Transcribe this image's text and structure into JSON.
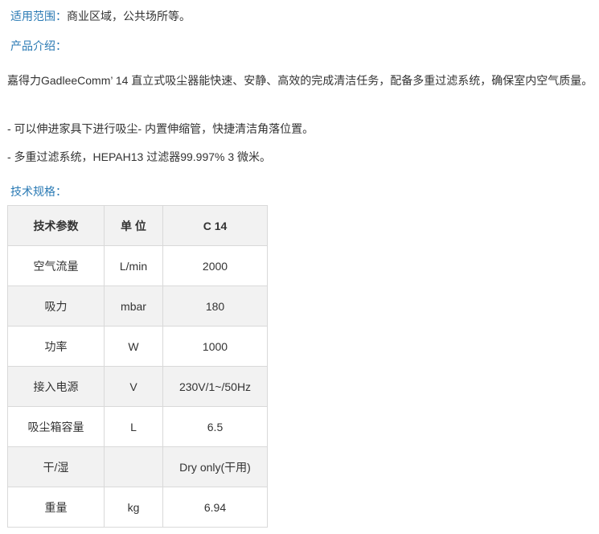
{
  "colors": {
    "accent": "#2a7ab4",
    "text": "#333333",
    "stripe": "#f2f2f2",
    "border": "#d9d9d9"
  },
  "scope": {
    "label": "适用范围：",
    "value": "商业区域，公共场所等。"
  },
  "intro": {
    "label": "产品介绍：",
    "description": "嘉得力GadleeComm’ 14 直立式吸尘器能快速、安静、高效的完成清洁任务，配备多重过滤系统，确保室内空气质量。",
    "bullets": [
      "- 可以伸进家具下进行吸尘- 内置伸缩管，快捷清洁角落位置。",
      "- 多重过滤系统，HEPAH13 过滤器99.997% 3 微米。"
    ]
  },
  "specs": {
    "label": "技术规格：",
    "headers": [
      "技术参数",
      "单 位",
      "C 14"
    ],
    "rows": [
      [
        "空气流量",
        "L/min",
        "2000"
      ],
      [
        "吸力",
        "mbar",
        "180"
      ],
      [
        "功率",
        "W",
        "1000"
      ],
      [
        "接入电源",
        "V",
        "230V/1~/50Hz"
      ],
      [
        "吸尘箱容量",
        "L",
        "6.5"
      ],
      [
        "干/湿",
        "",
        "Dry only(干用)"
      ],
      [
        "重量",
        "kg",
        "6.94"
      ]
    ]
  }
}
